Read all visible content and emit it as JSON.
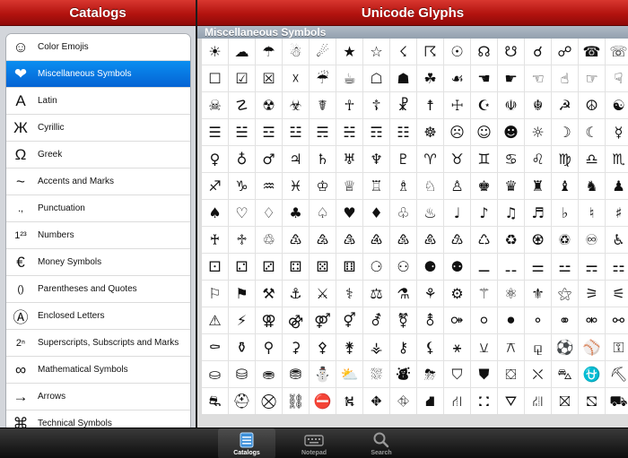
{
  "left": {
    "title": "Catalogs",
    "items": [
      {
        "icon": "☺",
        "icon_name": "smiley-icon",
        "label": "Color Emojis"
      },
      {
        "icon": "❤",
        "icon_name": "heart-icon",
        "label": "Miscellaneous Symbols",
        "selected": true
      },
      {
        "icon": "A",
        "icon_name": "latin-a-icon",
        "label": "Latin"
      },
      {
        "icon": "Ж",
        "icon_name": "cyrillic-zhe-icon",
        "label": "Cyrillic"
      },
      {
        "icon": "Ω",
        "icon_name": "omega-icon",
        "label": "Greek"
      },
      {
        "icon": "~",
        "icon_name": "tilde-icon",
        "label": "Accents and Marks"
      },
      {
        "icon": ".,",
        "icon_name": "punctuation-icon",
        "label": "Punctuation"
      },
      {
        "icon": "1²³",
        "icon_name": "numbers-icon",
        "label": "Numbers"
      },
      {
        "icon": "€",
        "icon_name": "euro-icon",
        "label": "Money Symbols"
      },
      {
        "icon": "()",
        "icon_name": "parentheses-icon",
        "label": "Parentheses and Quotes"
      },
      {
        "icon": "Ⓐ",
        "icon_name": "circled-a-icon",
        "label": "Enclosed Letters"
      },
      {
        "icon": "2ⁿ",
        "icon_name": "superscript-icon",
        "label": "Superscripts, Subscripts and Marks"
      },
      {
        "icon": "∞",
        "icon_name": "infinity-icon",
        "label": "Mathematical Symbols"
      },
      {
        "icon": "→",
        "icon_name": "arrow-icon",
        "label": "Arrows"
      },
      {
        "icon": "⌘",
        "icon_name": "command-icon",
        "label": "Technical Symbols"
      }
    ]
  },
  "right": {
    "title": "Unicode Glyphs",
    "section": "Miscellaneous Symbols",
    "glyphs": [
      "☀",
      "☁",
      "☂",
      "☃",
      "☄",
      "★",
      "☆",
      "☇",
      "☈",
      "☉",
      "☊",
      "☋",
      "☌",
      "☍",
      "☎",
      "☏",
      "☐",
      "☑",
      "☒",
      "☓",
      "☔",
      "☕",
      "☖",
      "☗",
      "☘",
      "☙",
      "☚",
      "☛",
      "☜",
      "☝",
      "☞",
      "☟",
      "☠",
      "☡",
      "☢",
      "☣",
      "☤",
      "☥",
      "☦",
      "☧",
      "☨",
      "☩",
      "☪",
      "☫",
      "☬",
      "☭",
      "☮",
      "☯",
      "☰",
      "☱",
      "☲",
      "☳",
      "☴",
      "☵",
      "☶",
      "☷",
      "☸",
      "☹",
      "☺",
      "☻",
      "☼",
      "☽",
      "☾",
      "☿",
      "♀",
      "♁",
      "♂",
      "♃",
      "♄",
      "♅",
      "♆",
      "♇",
      "♈",
      "♉",
      "♊",
      "♋",
      "♌",
      "♍",
      "♎",
      "♏",
      "♐",
      "♑",
      "♒",
      "♓",
      "♔",
      "♕",
      "♖",
      "♗",
      "♘",
      "♙",
      "♚",
      "♛",
      "♜",
      "♝",
      "♞",
      "♟",
      "♠",
      "♡",
      "♢",
      "♣",
      "♤",
      "♥",
      "♦",
      "♧",
      "♨",
      "♩",
      "♪",
      "♫",
      "♬",
      "♭",
      "♮",
      "♯",
      "♰",
      "♱",
      "♲",
      "♳",
      "♴",
      "♵",
      "♶",
      "♷",
      "♸",
      "♹",
      "♺",
      "♻",
      "♼",
      "♽",
      "♾",
      "♿",
      "⚀",
      "⚁",
      "⚂",
      "⚃",
      "⚄",
      "⚅",
      "⚆",
      "⚇",
      "⚈",
      "⚉",
      "⚊",
      "⚋",
      "⚌",
      "⚍",
      "⚎",
      "⚏",
      "⚐",
      "⚑",
      "⚒",
      "⚓",
      "⚔",
      "⚕",
      "⚖",
      "⚗",
      "⚘",
      "⚙",
      "⚚",
      "⚛",
      "⚜",
      "⚝",
      "⚞",
      "⚟",
      "⚠",
      "⚡",
      "⚢",
      "⚣",
      "⚤",
      "⚥",
      "⚦",
      "⚧",
      "⚨",
      "⚩",
      "⚪",
      "⚫",
      "⚬",
      "⚭",
      "⚮",
      "⚯",
      "⚰",
      "⚱",
      "⚲",
      "⚳",
      "⚴",
      "⚵",
      "⚶",
      "⚷",
      "⚸",
      "⚹",
      "⚺",
      "⚻",
      "⚼",
      "⚽",
      "⚾",
      "⚿",
      "⛀",
      "⛁",
      "⛂",
      "⛃",
      "⛄",
      "⛅",
      "⛆",
      "⛇",
      "⛈",
      "⛉",
      "⛊",
      "⛋",
      "⛌",
      "⛍",
      "⛎",
      "⛏",
      "⛐",
      "⛑",
      "⛒",
      "⛓",
      "⛔",
      "⛕",
      "⛖",
      "⛗",
      "⛘",
      "⛙",
      "⛚",
      "⛛",
      "⛜",
      "⛝",
      "⛞",
      "⛟"
    ]
  },
  "tabbar": {
    "tabs": [
      {
        "label": "Catalogs",
        "icon_name": "catalogs-icon",
        "active": true
      },
      {
        "label": "Notepad",
        "icon_name": "keyboard-icon"
      },
      {
        "label": "Search",
        "icon_name": "search-icon"
      }
    ]
  },
  "colors": {
    "navbar_red": "#b3130f",
    "selection_blue": "#0a8ef0",
    "section_header": "#a3aeba"
  }
}
